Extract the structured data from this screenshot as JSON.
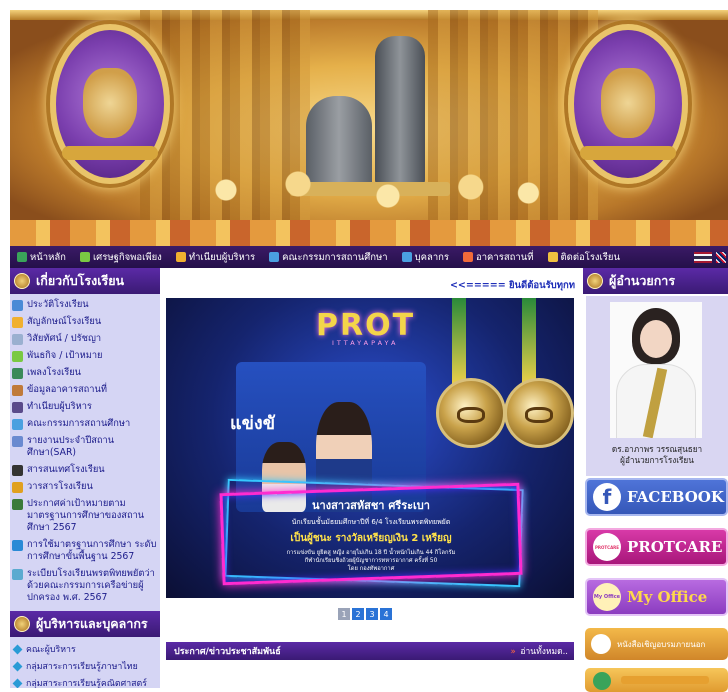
{
  "nav": {
    "items": [
      {
        "label": "หน้าหลัก",
        "icon": "home-icon",
        "color": "#3aa35a"
      },
      {
        "label": "เศรษฐกิจพอเพียง",
        "icon": "leaf-icon",
        "color": "#7ac943"
      },
      {
        "label": "ทำเนียบผู้บริหาร",
        "icon": "person-icon",
        "color": "#f0b030"
      },
      {
        "label": "คณะกรรมการสถานศึกษา",
        "icon": "board-icon",
        "color": "#4aa0e0"
      },
      {
        "label": "บุคลากร",
        "icon": "people-icon",
        "color": "#4aa0e0"
      },
      {
        "label": "อาคารสถานที่",
        "icon": "building-icon",
        "color": "#f06a3a"
      },
      {
        "label": "ติดต่อโรงเรียน",
        "icon": "mail-icon",
        "color": "#f0c040"
      }
    ]
  },
  "left": {
    "about_title": "เกี่ยวกับโรงเรียน",
    "about_items": [
      {
        "label": "ประวัติโรงเรียน",
        "icon": "book-icon",
        "color": "#4a8ad6"
      },
      {
        "label": "สัญลักษณ์โรงเรียน",
        "icon": "star-icon",
        "color": "#f0b030"
      },
      {
        "label": "วิสัยทัศน์ / ปรัชญา",
        "icon": "eye-icon",
        "color": "#9ab0d0"
      },
      {
        "label": "พันธกิจ / เป้าหมาย",
        "icon": "target-icon",
        "color": "#7ac943"
      },
      {
        "label": "เพลงโรงเรียน",
        "icon": "music-icon",
        "color": "#3a8a5a"
      },
      {
        "label": "ข้อมูลอาคารสถานที่",
        "icon": "building-icon",
        "color": "#c07a3a"
      },
      {
        "label": "ทำเนียบผู้บริหาร",
        "icon": "person-icon",
        "color": "#5a4a8a"
      },
      {
        "label": "คณะกรรมการสถานศึกษา",
        "icon": "board-icon",
        "color": "#4aa0e0"
      },
      {
        "label": "รายงานประจำปีสถานศึกษา(SAR)",
        "icon": "report-icon",
        "color": "#6a8ad0"
      },
      {
        "label": "สารสนเทศโรงเรียน",
        "icon": "info-icon",
        "color": "#333333"
      },
      {
        "label": "วารสารโรงเรียน",
        "icon": "journal-icon",
        "color": "#e0a020"
      },
      {
        "label": "ประกาศค่าเป้าหมายตามมาตรฐานการศึกษาของสถานศึกษา 2567",
        "icon": "announce-icon",
        "color": "#3a7a3a"
      },
      {
        "label": "การใช้มาตรฐานการศึกษา ระดับการศึกษาขั้นพื้นฐาน 2567",
        "icon": "standard-icon",
        "color": "#2a8ad6"
      },
      {
        "label": "ระเบียบโรงเรียนพรตพิทยพยัตว่าด้วยคณะกรรมการเครือข่ายผู้ปกครอง พ.ศ. 2567",
        "icon": "rule-icon",
        "color": "#5aaad0"
      }
    ],
    "staff_title": "ผู้บริหารและบุคลากร",
    "staff_items": [
      {
        "label": "คณะผู้บริหาร"
      },
      {
        "label": "กลุ่มสาระการเรียนรู้ภาษาไทย"
      },
      {
        "label": "กลุ่มสาระการเรียนรู้คณิตศาสตร์"
      }
    ]
  },
  "center": {
    "welcome": "<<===== ยินดีต้อนรับทุกท",
    "slide": {
      "logo_text": "PROT",
      "logo_sub": "ITTAYAPAYA",
      "student_name": "นางสาวสหัสชา ศรีระเบา",
      "student_line": "นักเรียนชั้นมัธยมศึกษาปีที่ 6/4 โรงเรียนพรตพิทยพยัต",
      "award": "เป็นผู้ชนะ รางวัลเหรียญเงิน 2 เหรียญ",
      "detail1": "การแข่งขัน ยูยิตสู หญิง อายุไม่เกิน 18 ปี น้ำหนักไม่เกิน 44 กิโลกรัม",
      "detail2": "กีฬานักเรียนชิงถ้วยผู้บัญชาการทหารอากาศ ครั้งที่ 50",
      "detail3": "โดย กองทัพอากาศ",
      "photo_text": "แข่งขั"
    },
    "pages": [
      "1",
      "2",
      "3",
      "4"
    ],
    "active_page": 1,
    "news_title": "ประกาศ/ข่าวประชาสัมพันธ์",
    "news_all": "อ่านทั้งหมด.."
  },
  "right": {
    "title": "ผู้อำนวยการ",
    "director_name": "ดร.อาภาพร วรรณสุนธยา",
    "director_role": "ผู้อำนวยการโรงเรียน",
    "facebook": "FACEBOOK",
    "protcare": "PROTCARE",
    "protcare_icon_text": "PROTCARE",
    "myoffice": "My Office",
    "myoffice_icon_text": "My Office",
    "invite": "หนังสือเชิญอบรมภายนอก"
  },
  "colors": {
    "nav_bg": "#2d1459",
    "sidebar_bg": "#d5d5f4",
    "header_purple": "#4a2190",
    "link_blue": "#1a1a8a",
    "facebook": "#3f63c8",
    "protcare": "#c0248e",
    "myoffice": "#a052d0"
  }
}
